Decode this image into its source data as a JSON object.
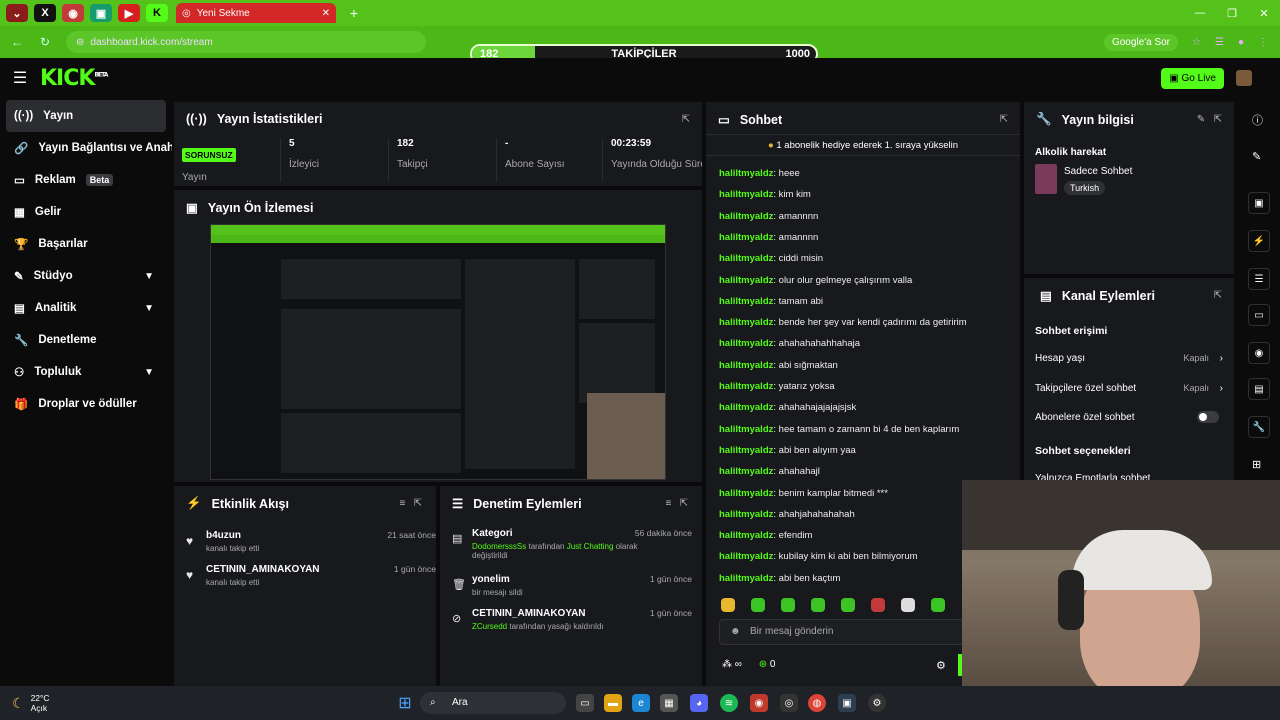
{
  "browser": {
    "tab_title": "Yeni Sekme",
    "url": "dashboard.kick.com/stream",
    "google_pill": "Google'a Sor"
  },
  "followers_bar": {
    "title": "TAKİPÇİLER",
    "current": 182,
    "goal": 1000,
    "progress": 0.182
  },
  "header": {
    "logo": "KICK",
    "logo_sup": "BETA",
    "go_live": "Go Live"
  },
  "sidebar": {
    "items": [
      {
        "label": "Yayın"
      },
      {
        "label": "Yayın Bağlantısı ve Anahtar"
      },
      {
        "label": "Reklam",
        "badge": "Beta"
      },
      {
        "label": "Gelir"
      },
      {
        "label": "Başarılar"
      },
      {
        "label": "Stüdyo"
      },
      {
        "label": "Analitik"
      },
      {
        "label": "Denetleme"
      },
      {
        "label": "Topluluk"
      },
      {
        "label": "Droplar ve ödüller"
      }
    ]
  },
  "stats": {
    "title": "Yayın İstatistikleri",
    "status": "SORUNSUZ",
    "status_label": "Yayın",
    "viewers": "5",
    "viewers_label": "İzleyici",
    "followers": "182",
    "followers_label": "Takipçi",
    "subs": "-",
    "subs_label": "Abone Sayısı",
    "uptime": "00:23:59",
    "uptime_label": "Yayında Olduğu Süre"
  },
  "preview": {
    "title": "Yayın Ön İzlemesi"
  },
  "activity": {
    "title": "Etkinlik Akışı",
    "items": [
      {
        "name": "b4uzun",
        "sub": "kanalı takip etti",
        "time": "21 saat önce"
      },
      {
        "name": "CETININ_AMINAKOYAN",
        "sub": "kanalı takip etti",
        "time": "1 gün önce"
      }
    ]
  },
  "moderation": {
    "title": "Denetim Eylemleri",
    "items": [
      {
        "name": "Kategori",
        "user": "DodomersssSs",
        "mid": " tarafından ",
        "target": "Just Chatting",
        "tail": " olarak değiştirildi",
        "time": "56 dakika önce"
      },
      {
        "name": "yonelim",
        "sub": "bir mesajı sildi",
        "time": "1 gün önce"
      },
      {
        "name": "CETININ_AMINAKOYAN",
        "user": "ZCursedd",
        "tail": " tarafından yasağı kaldırıldı",
        "time": "1 gün önce"
      }
    ]
  },
  "chat": {
    "title": "Sohbet",
    "pinned": "1 abonelik hediye ederek 1. sıraya yükselin",
    "user": "haliltmyaldz",
    "messages": [
      "heee",
      "kim kim",
      "amannnn",
      "amannnn",
      "ciddi misin",
      "olur olur gelmeye çalışırım valla",
      "tamam abi",
      "bende her şey var kendi çadırımı da getiririm",
      "ahahahahahhahaja",
      "abi sığmaktan",
      "yatarız yoksa",
      "ahahahajajajajsjsk",
      "hee tamam o zamann bi 4 de ben kaplarım",
      "abi ben alıyım yaa",
      "ahahahajl",
      "benim kamplar bitmedi ***",
      "ahahjahahahahah",
      "efendim",
      "kubilay kim ki abi ben bilmiyorum",
      "abi ben kaçtım"
    ],
    "input_placeholder": "Bir mesaj gönderin",
    "count": "0",
    "colors": {
      "accent": "#53fc18"
    }
  },
  "stream_info": {
    "title": "Yayın bilgisi",
    "stream_title": "Alkolik harekat",
    "category": "Sadece Sohbet",
    "language": "Turkish"
  },
  "channel_actions": {
    "title": "Kanal Eylemleri",
    "chat_access": "Sohbet erişimi",
    "account_age": "Hesap yaşı",
    "account_age_val": "Kapalı",
    "followers_only": "Takipçilere özel sohbet",
    "followers_only_val": "Kapalı",
    "subs_only": "Abonelere özel sohbet",
    "chat_options": "Sohbet seçenekleri",
    "emotes_only": "Yalnızca Emotlarla sohbet"
  },
  "taskbar": {
    "temp": "22°C",
    "condition": "Açık",
    "search": "Ara"
  }
}
